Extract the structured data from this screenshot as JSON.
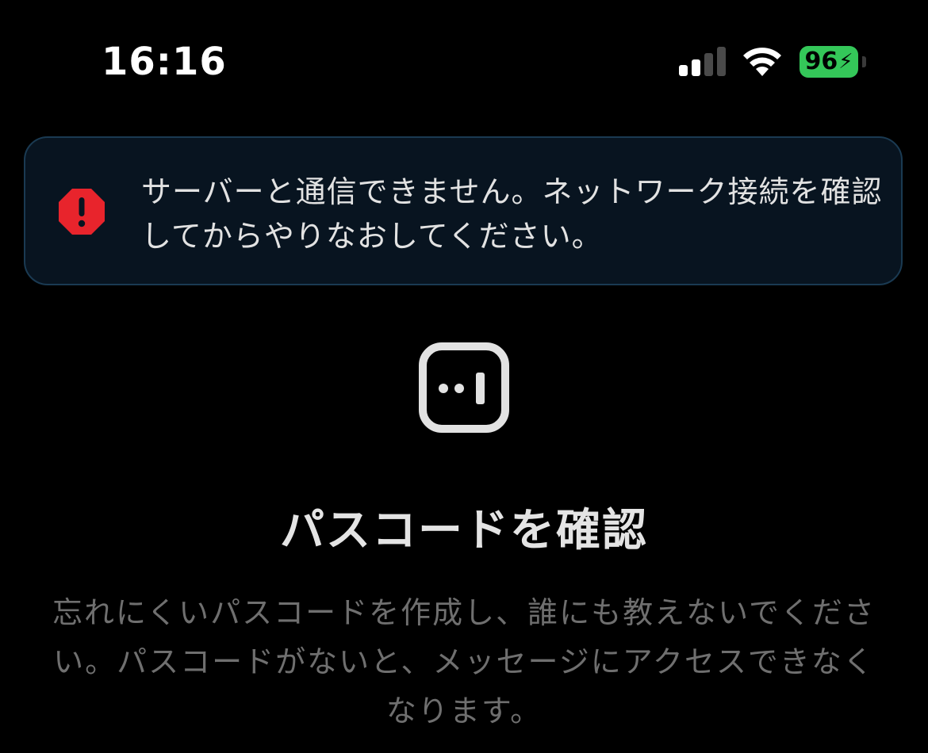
{
  "status_bar": {
    "time": "16:16",
    "signal_icon": "cellular-signal-icon",
    "signal_bars_active": 2,
    "signal_bars_total": 4,
    "wifi_icon": "wifi-icon",
    "battery_icon": "battery-charging-icon",
    "battery_percent": "96",
    "battery_color": "#34c759"
  },
  "error_banner": {
    "icon": "error-octagon-icon",
    "icon_color": "#e8242c",
    "message": "サーバーと通信できません。ネットワーク接続を確認してからやりなおしてください。"
  },
  "passcode": {
    "icon": "passcode-field-icon",
    "title": "パスコードを確認",
    "description": "忘れにくいパスコードを作成し、誰にも教えないでください。パスコードがないと、メッセージにアクセスできなくなります。"
  },
  "colors": {
    "background": "#000000",
    "banner_background": "#081420",
    "banner_border": "#1a3a52",
    "title_text": "#e4e4e4",
    "description_text": "#6f6f6f"
  }
}
